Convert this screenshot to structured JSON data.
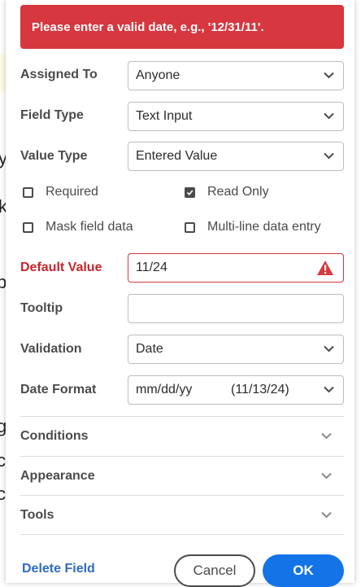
{
  "error": {
    "message": "Please enter a valid date, e.g., '12/31/11'."
  },
  "fields": {
    "assigned_to": {
      "label": "Assigned To",
      "value": "Anyone"
    },
    "field_type": {
      "label": "Field Type",
      "value": "Text Input"
    },
    "value_type": {
      "label": "Value Type",
      "value": "Entered Value"
    },
    "default_value": {
      "label": "Default Value",
      "value": "11/24"
    },
    "tooltip": {
      "label": "Tooltip",
      "value": ""
    },
    "validation": {
      "label": "Validation",
      "value": "Date"
    },
    "date_format": {
      "label": "Date Format",
      "value": "mm/dd/yy",
      "example": "(11/13/24)"
    }
  },
  "options": {
    "required": {
      "label": "Required",
      "checked": false
    },
    "read_only": {
      "label": "Read Only",
      "checked": true
    },
    "mask_field_data": {
      "label": "Mask field data",
      "checked": false
    },
    "multi_line": {
      "label": "Multi-line data entry",
      "checked": false
    }
  },
  "sections": {
    "conditions": "Conditions",
    "appearance": "Appearance",
    "tools": "Tools"
  },
  "footer": {
    "delete_label": "Delete Field",
    "cancel_label": "Cancel",
    "ok_label": "OK"
  },
  "background": {
    "fragment_1": "y",
    "fragment_2": "k",
    "fragment_3": "b",
    "fragment_4": "g",
    "fragment_5": "c",
    "fragment_6": "c"
  },
  "colors": {
    "error": "#d7373f",
    "primary": "#1473e6",
    "link": "#2d6cc4"
  }
}
